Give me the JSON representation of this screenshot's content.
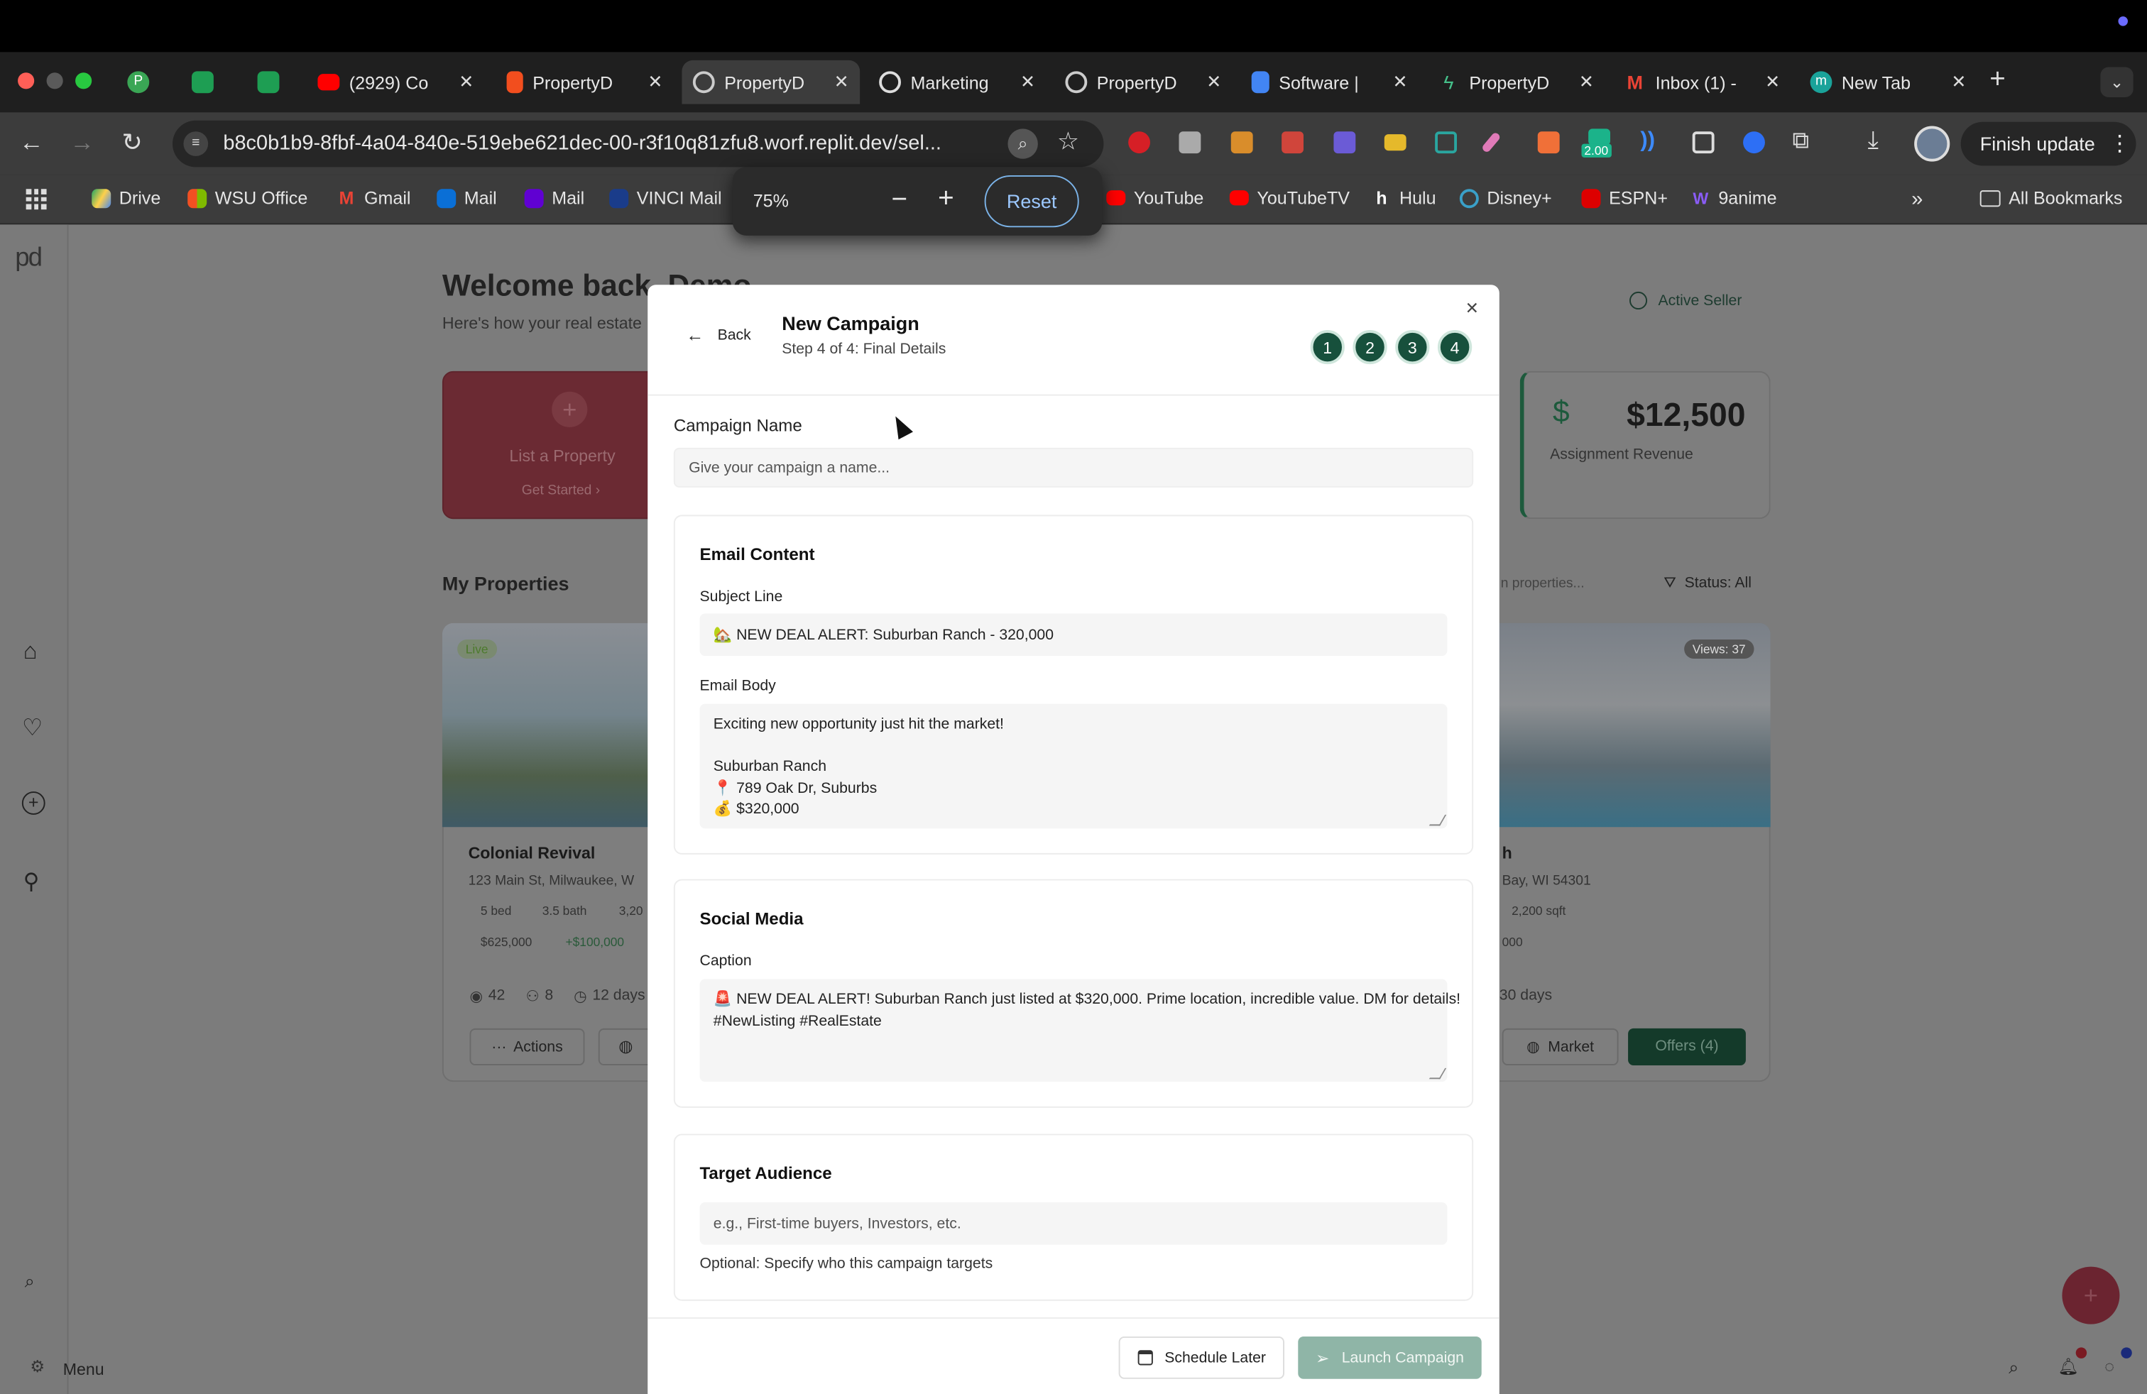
{
  "browser": {
    "tabs": [
      {
        "label": ""
      },
      {
        "label": ""
      },
      {
        "label": ""
      },
      {
        "label": "(2929) Co"
      },
      {
        "label": "PropertyD"
      },
      {
        "label": "PropertyD"
      },
      {
        "label": "Marketing"
      },
      {
        "label": "PropertyD"
      },
      {
        "label": "Software |"
      },
      {
        "label": "PropertyD"
      },
      {
        "label": "Inbox (1) -"
      },
      {
        "label": "New Tab"
      }
    ],
    "url": "b8c0b1b9-8fbf-4a04-840e-519ebe621dec-00-r3f10q81zfu8.worf.replit.dev/sel...",
    "extension_badge": "2.00",
    "finish_update": "Finish update",
    "bookmarks": [
      "Drive",
      "WSU Office",
      "Gmail",
      "Mail",
      "Mail",
      "VINCI Mail",
      "YouTube",
      "YouTubeTV",
      "Hulu",
      "Disney+",
      "ESPN+",
      "9anime"
    ],
    "all_bookmarks": "All Bookmarks",
    "zoom": {
      "level": "75%",
      "reset": "Reset"
    }
  },
  "app": {
    "logo": "pd",
    "welcome": "Welcome back, Demo",
    "subtitle": "Here's how your real estate",
    "active_seller": "Active Seller",
    "list_property": "List a Property",
    "get_started": "Get Started ›",
    "revenue": {
      "value": "$12,500",
      "label": "Assignment Revenue"
    },
    "my_properties": "My Properties",
    "search_placeholder": "n properties...",
    "status_filter": "Status: All",
    "left_property": {
      "badge": "Live",
      "name": "Colonial Revival",
      "address": "123 Main St, Milwaukee, W",
      "beds": "5 bed",
      "baths": "3.5 bath",
      "sqft": "3,20",
      "price": "$625,000",
      "delta": "+$100,000",
      "views": "42",
      "users": "8",
      "days": "12 days",
      "actions": "Actions"
    },
    "right_property": {
      "views_badge": "Views: 37",
      "name": "h",
      "address": "Bay, WI 54301",
      "sqft": "2,200 sqft",
      "price": "000",
      "days": "30 days",
      "market": "Market",
      "offers": "Offers (4)"
    },
    "menu": "Menu"
  },
  "modal": {
    "back": "Back",
    "title": "New Campaign",
    "subtitle": "Step 4 of 4: Final Details",
    "steps": [
      "1",
      "2",
      "3",
      "4"
    ],
    "campaign_name": {
      "label": "Campaign Name",
      "placeholder": "Give your campaign a name..."
    },
    "email": {
      "heading": "Email Content",
      "subject_label": "Subject Line",
      "subject_value": "🏡 NEW DEAL ALERT: Suburban Ranch - 320,000",
      "body_label": "Email Body",
      "body_lines": [
        "Exciting new opportunity just hit the market!",
        "",
        "Suburban Ranch",
        "📍 789 Oak Dr, Suburbs",
        "💰 $320,000"
      ]
    },
    "social": {
      "heading": "Social Media",
      "caption_label": "Caption",
      "caption_lines": [
        "🚨 NEW DEAL ALERT! Suburban Ranch just listed at $320,000. Prime location, incredible value. DM for details!",
        "#NewListing #RealEstate"
      ]
    },
    "audience": {
      "heading": "Target Audience",
      "placeholder": "e.g., First-time buyers, Investors, etc.",
      "hint": "Optional: Specify who this campaign targets"
    },
    "schedule_later": "Schedule Later",
    "launch": "Launch Campaign"
  },
  "colors": {
    "accent": "#17503c",
    "launch_disabled": "#8fb5a7"
  }
}
